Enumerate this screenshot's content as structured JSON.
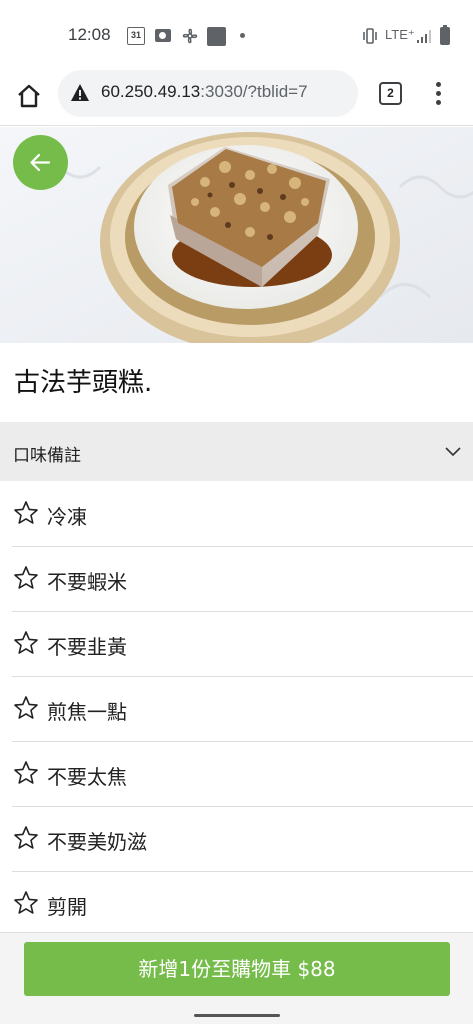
{
  "status_bar": {
    "time": "12:08",
    "calendar_day": "31",
    "network": "LTE⁺"
  },
  "browser": {
    "url_host": "60.250.49.13",
    "url_rest": ":3030/?tblid=7",
    "tab_count": "2"
  },
  "item": {
    "title": "古法芋頭糕."
  },
  "section": {
    "title": "口味備註"
  },
  "options": [
    {
      "label": "冷凍"
    },
    {
      "label": "不要蝦米"
    },
    {
      "label": "不要韭黃"
    },
    {
      "label": "煎焦一點"
    },
    {
      "label": "不要太焦"
    },
    {
      "label": "不要美奶滋"
    },
    {
      "label": "剪開"
    }
  ],
  "cart_button": {
    "label": "新增1份至購物車 $88"
  },
  "colors": {
    "accent": "#76bc4b",
    "section_bg": "#ececec"
  }
}
